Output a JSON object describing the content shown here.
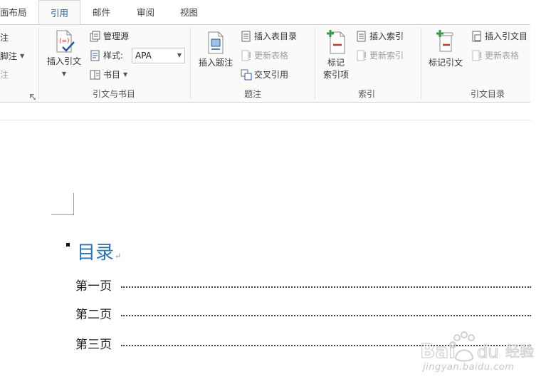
{
  "tabs": [
    "面布局",
    "引用",
    "邮件",
    "审阅",
    "视图"
  ],
  "left_partial": {
    "item1": "注",
    "item2": "脚注",
    "item3": "注"
  },
  "citations_group": {
    "insert_citation": "插入引文",
    "manage_sources": "管理源",
    "style_label": "样式:",
    "style_value": "APA",
    "bibliography": "书目",
    "label": "引文与书目"
  },
  "captions_group": {
    "insert_caption": "插入题注",
    "insert_table_of_figures": "插入表目录",
    "update_table": "更新表格",
    "cross_reference": "交叉引用",
    "label": "题注"
  },
  "index_group": {
    "mark_entry_line1": "标记",
    "mark_entry_line2": "索引项",
    "insert_index": "插入索引",
    "update_index": "更新索引",
    "label": "索引"
  },
  "toa_group": {
    "mark_citation": "标记引文",
    "insert_toa": "插入引文目",
    "update_table": "更新表格",
    "label": "引文目录"
  },
  "document": {
    "heading": "目录",
    "paragraph_mark": "↵",
    "toc_entries": [
      "第一页",
      "第二页",
      "第三页"
    ]
  },
  "watermark": {
    "logo_text": "Bai 经验",
    "url": "jingyan.baidu.com"
  },
  "colors": {
    "accent": "#2b579a",
    "heading_blue": "#2e74b5",
    "disabled": "#a0a0a0"
  }
}
